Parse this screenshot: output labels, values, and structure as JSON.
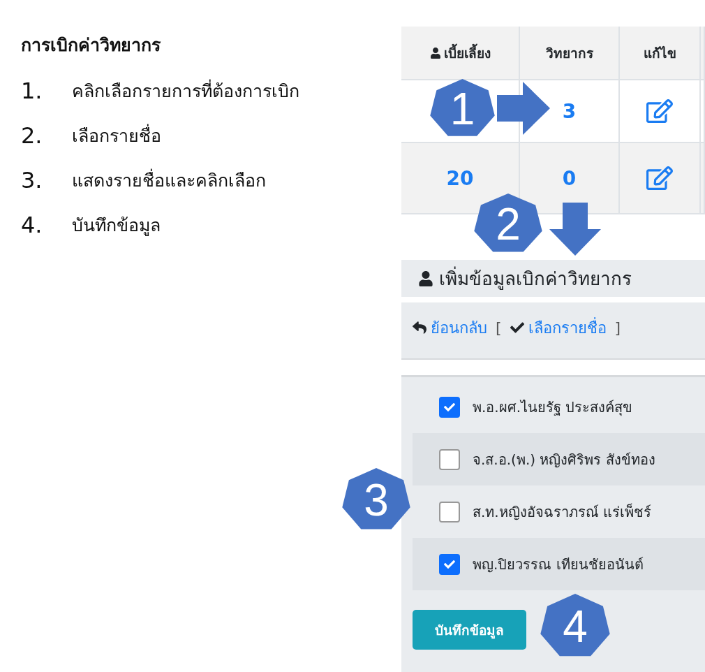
{
  "instructions": {
    "title": "การเบิกค่าวิทยากร",
    "steps": [
      {
        "number": "1.",
        "text": "คลิกเลือกรายการที่ต้องการเบิก"
      },
      {
        "number": "2.",
        "text": "เลือกรายชื่อ"
      },
      {
        "number": "3.",
        "text": "แสดงรายชื่อและคลิกเลือก"
      },
      {
        "number": "4.",
        "text": "บันทึกข้อมูล"
      }
    ]
  },
  "table": {
    "columns": [
      "เบี้ยเลี้ยง",
      "วิทยากร",
      "แก้ไข"
    ],
    "rows": [
      {
        "trainer": "3"
      },
      {
        "allowance": "20",
        "trainer": "0"
      }
    ]
  },
  "panel": {
    "title": "เพิ่มข้อมูลเบิกค่าวิทยากร",
    "back_link": "ย้อนกลับ",
    "open_bracket": "[",
    "select_link": "เลือกรายชื่อ",
    "close_bracket": "]",
    "people": [
      {
        "name": "พ.อ.ผศ.ไนยรัฐ ประสงค์สุข",
        "checked": true
      },
      {
        "name": "จ.ส.อ.(พ.) หญิงศิริพร สังข์ทอง",
        "checked": false
      },
      {
        "name": "ส.ท.หญิงอัจฉราภรณ์ แร่เพ็ชร์",
        "checked": false
      },
      {
        "name": "พญ.ปิยวรรณ เทียนชัยอนันต์",
        "checked": true
      }
    ],
    "save_button": "บันทึกข้อมูล"
  },
  "callouts": [
    {
      "number": "1"
    },
    {
      "number": "2"
    },
    {
      "number": "3"
    },
    {
      "number": "4"
    }
  ]
}
